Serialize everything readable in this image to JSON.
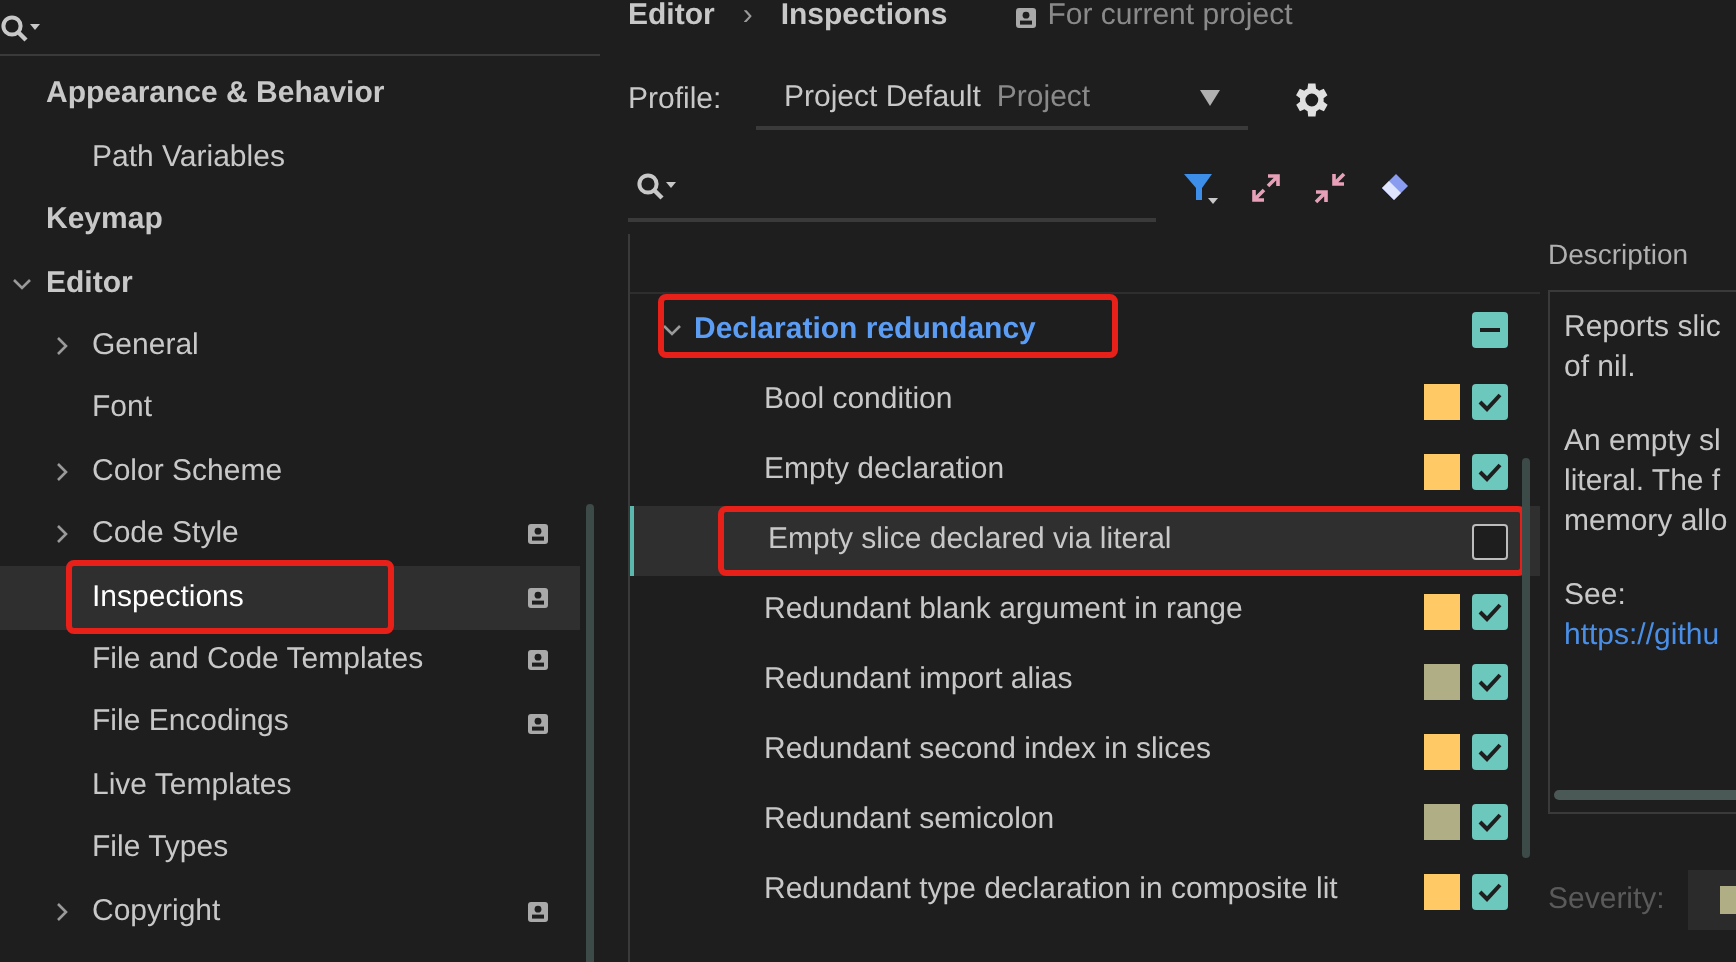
{
  "sidebar": {
    "items": [
      {
        "label": "Appearance & Behavior",
        "chevron": false,
        "children": [
          {
            "label": "Path Variables",
            "chevron": false,
            "project": false,
            "selected": false,
            "highlighted": false
          }
        ]
      },
      {
        "label": "Keymap",
        "chevron": false
      },
      {
        "label": "Editor",
        "chevron": true,
        "expanded": true,
        "children": [
          {
            "label": "General",
            "chevron": true,
            "expanded": false,
            "project": false,
            "selected": false,
            "highlighted": false
          },
          {
            "label": "Font",
            "chevron": false,
            "project": false,
            "selected": false,
            "highlighted": false
          },
          {
            "label": "Color Scheme",
            "chevron": true,
            "expanded": false,
            "project": false,
            "selected": false,
            "highlighted": false
          },
          {
            "label": "Code Style",
            "chevron": true,
            "expanded": false,
            "project": true,
            "selected": false,
            "highlighted": false
          },
          {
            "label": "Inspections",
            "chevron": false,
            "project": true,
            "selected": true,
            "highlighted": true
          },
          {
            "label": "File and Code Templates",
            "chevron": false,
            "project": true,
            "selected": false,
            "highlighted": false
          },
          {
            "label": "File Encodings",
            "chevron": false,
            "project": true,
            "selected": false,
            "highlighted": false
          },
          {
            "label": "Live Templates",
            "chevron": false,
            "project": false,
            "selected": false,
            "highlighted": false
          },
          {
            "label": "File Types",
            "chevron": false,
            "project": false,
            "selected": false,
            "highlighted": false
          },
          {
            "label": "Copyright",
            "chevron": true,
            "expanded": false,
            "project": true,
            "selected": false,
            "highlighted": false
          }
        ]
      }
    ]
  },
  "breadcrumb": {
    "parent": "Editor",
    "separator": "›",
    "current": "Inspections",
    "scope": "For current project"
  },
  "profile": {
    "label": "Profile:",
    "value": "Project Default",
    "hint": "Project"
  },
  "inspections": {
    "category": {
      "label": "Declaration redundancy",
      "expanded": true,
      "indeterminate": true,
      "highlighted": true
    },
    "items": [
      {
        "label": "Bool condition",
        "color": "#ffc966",
        "checked": true,
        "selected": false,
        "highlighted": false
      },
      {
        "label": "Empty declaration",
        "color": "#ffc966",
        "checked": true,
        "selected": false,
        "highlighted": false
      },
      {
        "label": "Empty slice declared via literal",
        "checked": false,
        "selected": true,
        "highlighted": true
      },
      {
        "label": "Redundant blank argument in range",
        "color": "#ffc966",
        "checked": true,
        "selected": false,
        "highlighted": false
      },
      {
        "label": "Redundant import alias",
        "color": "#b0ae85",
        "checked": true,
        "selected": false,
        "highlighted": false
      },
      {
        "label": "Redundant second index in slices",
        "color": "#ffc966",
        "checked": true,
        "selected": false,
        "highlighted": false
      },
      {
        "label": "Redundant semicolon",
        "color": "#b0ae85",
        "checked": true,
        "selected": false,
        "highlighted": false
      },
      {
        "label": "Redundant type declaration in composite lit",
        "color": "#ffc966",
        "checked": true,
        "selected": false,
        "highlighted": false
      }
    ]
  },
  "description": {
    "title": "Description",
    "paragraphs": [
      [
        "Reports slic",
        "of nil."
      ],
      [
        "An empty sl",
        "literal. The f",
        "memory allo"
      ],
      [
        "See:"
      ]
    ],
    "link": "https://githu",
    "severity_label": "Severity:"
  }
}
